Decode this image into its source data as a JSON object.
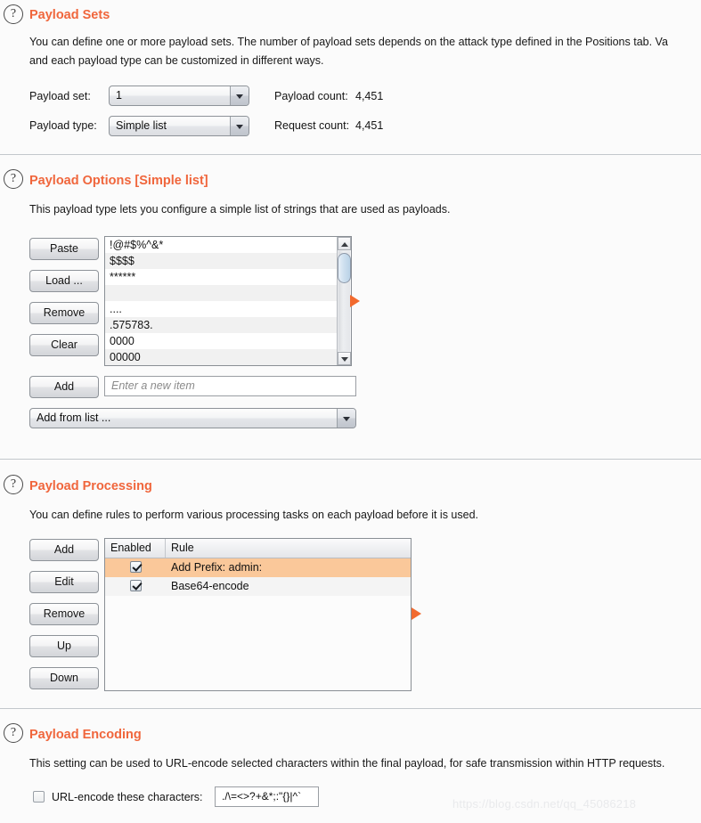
{
  "sections": {
    "payload_sets": {
      "help_icon": "question-mark-icon",
      "title": "Payload Sets",
      "desc_line1": "You can define one or more payload sets. The number of payload sets depends on the attack type defined in the Positions tab. Va",
      "desc_line2": "and each payload type can be customized in different ways.",
      "payload_set_label": "Payload set:",
      "payload_set_value": "1",
      "payload_type_label": "Payload type:",
      "payload_type_value": "Simple list",
      "payload_count_label": "Payload count:",
      "payload_count_value": "4,451",
      "request_count_label": "Request count:",
      "request_count_value": "4,451"
    },
    "payload_options": {
      "help_icon": "question-mark-icon",
      "title": "Payload Options [Simple list]",
      "desc": "This payload type lets you configure a simple list of strings that are used as payloads.",
      "buttons": [
        {
          "label": "Paste",
          "name": "paste-button"
        },
        {
          "label": "Load ...",
          "name": "load-button"
        },
        {
          "label": "Remove",
          "name": "remove-button"
        },
        {
          "label": "Clear",
          "name": "clear-button"
        }
      ],
      "list_items": [
        "!@#$%^&*",
        "$$$$",
        "******",
        "",
        "....",
        ".575783.",
        "0000",
        "00000"
      ],
      "add_button": "Add",
      "new_item_placeholder": "Enter a new item",
      "new_item_value": "",
      "add_from_list_value": "Add from list ..."
    },
    "payload_processing": {
      "help_icon": "question-mark-icon",
      "title": "Payload Processing",
      "desc": "You can define rules to perform various processing tasks on each payload before it is used.",
      "buttons": [
        {
          "label": "Add",
          "name": "add-rule-button"
        },
        {
          "label": "Edit",
          "name": "edit-rule-button"
        },
        {
          "label": "Remove",
          "name": "remove-rule-button"
        },
        {
          "label": "Up",
          "name": "move-up-button"
        },
        {
          "label": "Down",
          "name": "move-down-button"
        }
      ],
      "columns": [
        "Enabled",
        "Rule"
      ],
      "rows": [
        {
          "enabled": true,
          "rule": "Add Prefix: admin:",
          "selected": true
        },
        {
          "enabled": true,
          "rule": "Base64-encode",
          "selected": false
        }
      ]
    },
    "payload_encoding": {
      "help_icon": "question-mark-icon",
      "title": "Payload Encoding",
      "desc": "This setting can be used to URL-encode selected characters within the final payload, for safe transmission within HTTP requests.",
      "checkbox_checked": false,
      "checkbox_label": "URL-encode these characters:",
      "chars_value": "./\\=<>?+&*;:\"{}|^`"
    }
  },
  "markers": {
    "icon": "play-triangle-marker"
  },
  "watermark": {
    "text": "https://blog.csdn.net/qq_45086218"
  },
  "colors": {
    "accent": "#f0663c",
    "selection": "#fac89a",
    "marker": "#f26a2e"
  }
}
